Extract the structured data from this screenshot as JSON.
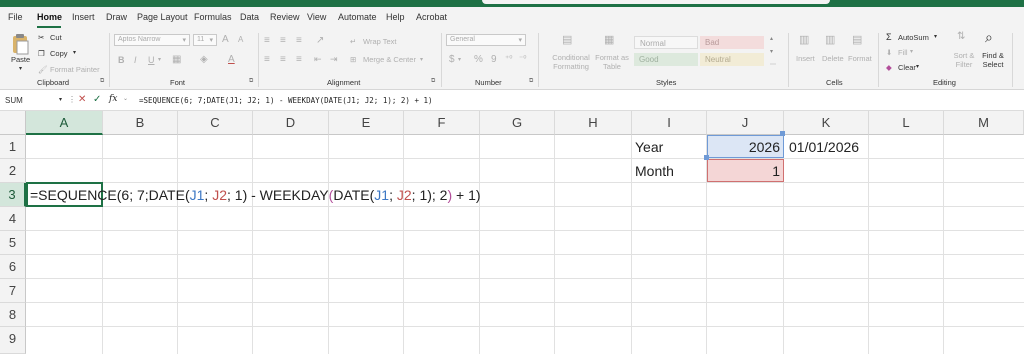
{
  "menu": [
    "File",
    "Home",
    "Insert",
    "Draw",
    "Page Layout",
    "Formulas",
    "Data",
    "Review",
    "View",
    "Automate",
    "Help",
    "Acrobat"
  ],
  "ribbon": {
    "clipboard": {
      "paste": "Paste",
      "cut": "Cut",
      "copy": "Copy",
      "format_painter": "Format Painter",
      "group": "Clipboard"
    },
    "font": {
      "name": "Aptos Narrow",
      "size": "11",
      "bold": "B",
      "italic": "I",
      "underline": "U",
      "grow": "A",
      "shrink": "A",
      "group": "Font"
    },
    "alignment": {
      "wrap": "Wrap Text",
      "merge": "Merge & Center",
      "group": "Alignment"
    },
    "number": {
      "format": "General",
      "currency": "$",
      "percent": "%",
      "comma": "9",
      "group": "Number"
    },
    "styles": {
      "conditional": "Conditional\nFormatting",
      "format_table": "Format as\nTable",
      "normal": "Normal",
      "bad": "Bad",
      "good": "Good",
      "neutral": "Neutral",
      "group": "Styles"
    },
    "cells": {
      "insert": "Insert",
      "delete": "Delete",
      "format": "Format",
      "group": "Cells"
    },
    "editing": {
      "autosum": "AutoSum",
      "fill": "Fill",
      "clear": "Clear",
      "sort": "Sort &\nFilter",
      "find": "Find &\nSelect",
      "group": "Editing"
    }
  },
  "formula_bar": {
    "name_box": "SUM",
    "fx": "fx",
    "formula": "=SEQUENCE(6; 7;DATE(J1; J2; 1) - WEEKDAY(DATE(J1; J2; 1); 2) + 1)"
  },
  "sheet": {
    "columns": [
      "A",
      "B",
      "C",
      "D",
      "E",
      "F",
      "G",
      "H",
      "I",
      "J",
      "K",
      "L",
      "M"
    ],
    "rows": [
      "1",
      "2",
      "3",
      "4",
      "5",
      "6",
      "7",
      "8",
      "9"
    ],
    "selected_column": "A",
    "selected_row": "3",
    "cells": {
      "I1": "Year",
      "J1": "2026",
      "K1": "01/01/2026",
      "I2": "Month",
      "J2": "1"
    },
    "a3_formula_parts": [
      {
        "text": "=SEQUENCE(6; 7;DATE(",
        "color": "#222222"
      },
      {
        "text": "J1",
        "color": "#3d78c4"
      },
      {
        "text": "; ",
        "color": "#222222"
      },
      {
        "text": "J2",
        "color": "#c0504d"
      },
      {
        "text": "; 1) - WEEKDAY",
        "color": "#222222"
      },
      {
        "text": "(",
        "color": "#b24e9a"
      },
      {
        "text": "DATE(",
        "color": "#222222"
      },
      {
        "text": "J1",
        "color": "#3d78c4"
      },
      {
        "text": "; ",
        "color": "#222222"
      },
      {
        "text": "J2",
        "color": "#c0504d"
      },
      {
        "text": "; 1); 2",
        "color": "#222222"
      },
      {
        "text": ")",
        "color": "#b24e9a"
      },
      {
        "text": " + 1)",
        "color": "#222222"
      }
    ],
    "colors": {
      "accent": "#1e7145",
      "j1_fill": "#dce6f5",
      "j2_fill": "#f4d6d6"
    }
  }
}
